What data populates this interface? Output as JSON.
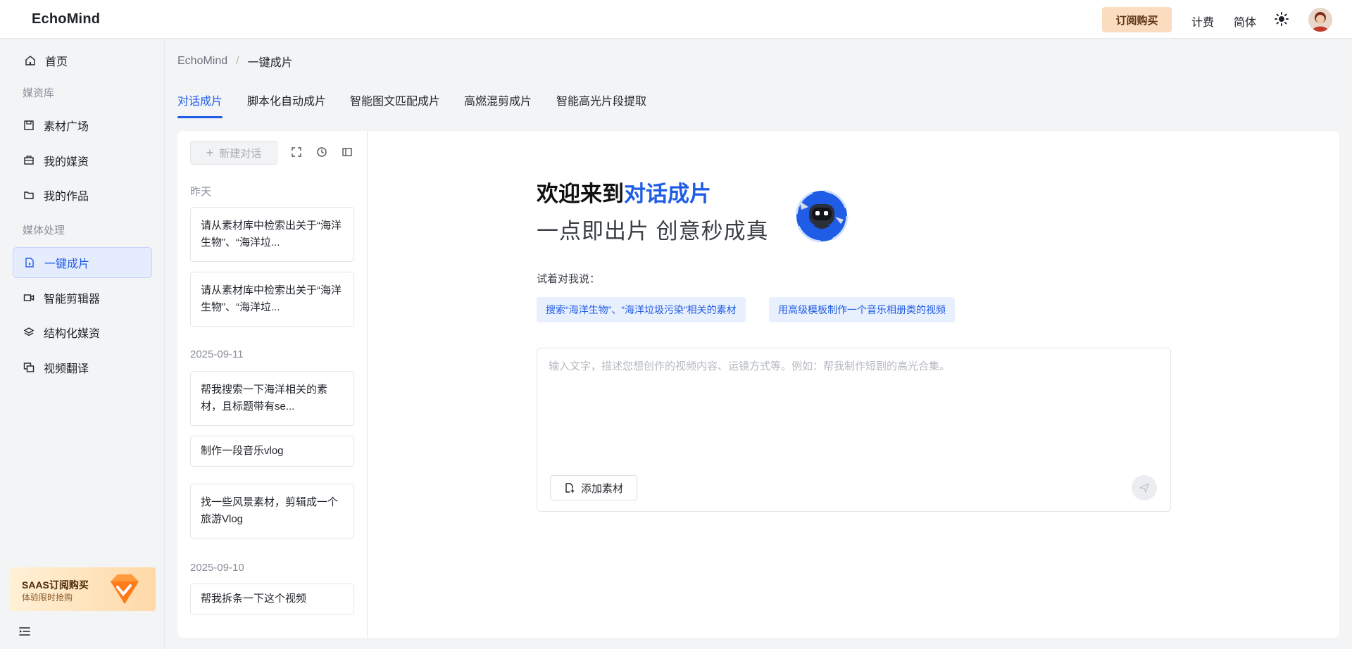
{
  "app": {
    "brand": "EchoMind"
  },
  "header": {
    "subscribe_label": "订阅购买",
    "billing_label": "计费",
    "language_label": "简体",
    "theme_icon": "sun-icon",
    "avatar_icon": "user-avatar"
  },
  "sidebar": {
    "home": "首页",
    "group_library": "媒资库",
    "material_plaza": "素材广场",
    "my_assets": "我的媒资",
    "my_works": "我的作品",
    "group_processing": "媒体处理",
    "one_click": "一键成片",
    "smart_editor": "智能剪辑器",
    "structured_assets": "结构化媒资",
    "video_translate": "视频翻译",
    "promo_title": "SAAS订阅购买",
    "promo_sub": "体验限时抢购"
  },
  "breadcrumb": {
    "root": "EchoMind",
    "separator": "/",
    "current": "一键成片"
  },
  "tabs": [
    "对话成片",
    "脚本化自动成片",
    "智能图文匹配成片",
    "高燃混剪成片",
    "智能高光片段提取"
  ],
  "history": {
    "new_chat_label": "新建对话",
    "groups": [
      {
        "date": "昨天",
        "items": [
          "请从素材库中检索出关于“海洋生物”、“海洋垃...",
          "请从素材库中检索出关于“海洋生物”、“海洋垃..."
        ]
      },
      {
        "date": "2025-09-11",
        "items": [
          "帮我搜索一下海洋相关的素材，且标题带有se...",
          "制作一段音乐vlog",
          "找一些风景素材，剪辑成一个旅游Vlog"
        ]
      },
      {
        "date": "2025-09-10",
        "items": [
          "帮我拆条一下这个视频"
        ]
      }
    ]
  },
  "welcome": {
    "title_prefix": "欢迎来到",
    "title_accent": "对话成片",
    "subtitle": "一点即出片 创意秒成真",
    "try_label": "试着对我说：",
    "suggestions": [
      "搜索“海洋生物”、“海洋垃圾污染”相关的素材",
      "用高级模板制作一个音乐相册类的视频"
    ]
  },
  "composer": {
    "placeholder": "输入文字，描述您想创作的视频内容、运镜方式等。例如：帮我制作短剧的高光合集。",
    "value": "",
    "add_material_label": "添加素材"
  },
  "colors": {
    "accent": "#1f5de6",
    "subscribe_bg": "#fcdcbf",
    "chip_bg": "#e8effd"
  }
}
